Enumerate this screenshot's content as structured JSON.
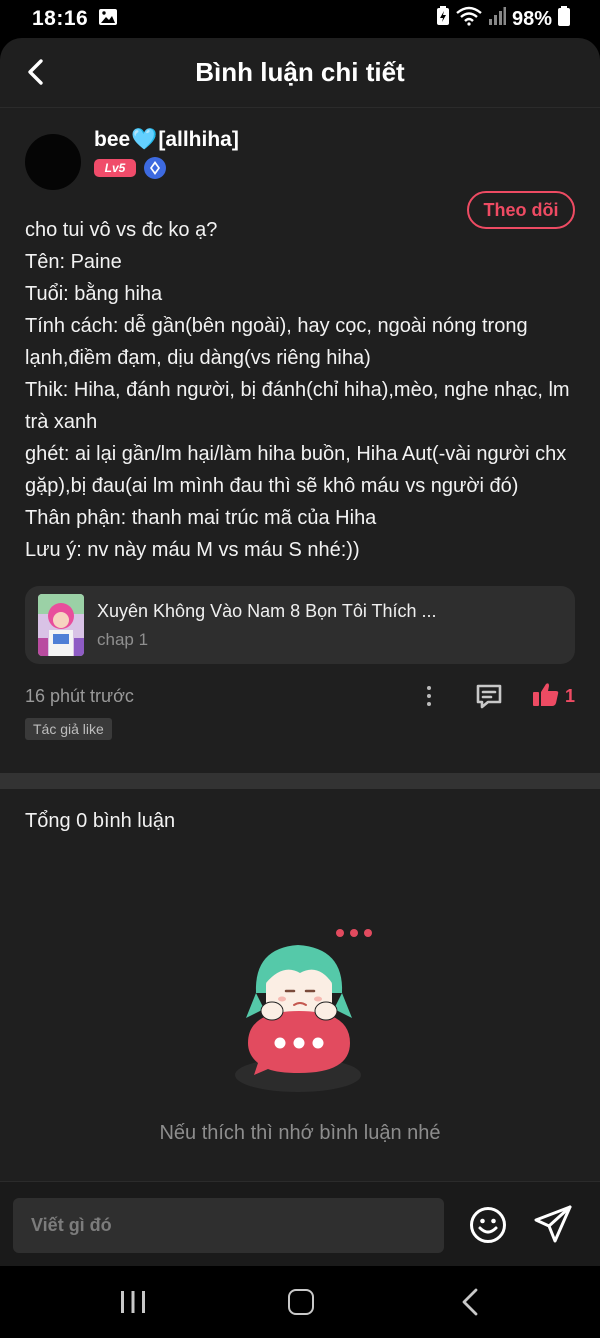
{
  "status_bar": {
    "time": "18:16",
    "battery": "98%",
    "icons": [
      "gallery-icon",
      "battery-saver-icon",
      "wifi-icon",
      "signal-icon",
      "battery-icon"
    ]
  },
  "header": {
    "title": "Bình luận chi tiết",
    "back_icon": "chevron-left-icon"
  },
  "post": {
    "author": {
      "name_prefix": "bee",
      "name_heart": "🩵",
      "name_suffix": "[allhiha]",
      "level": "Lv5"
    },
    "follow_label": "Theo dõi",
    "lines": [
      "cho tui vô vs đc ko ạ?",
      "Tên: Paine",
      "Tuổi: bằng hiha",
      "Tính cách: dễ gần(bên ngoài), hay cọc, ngoài nóng trong lạnh,điềm đạm, dịu dàng(vs riêng hiha)",
      "Thik: Hiha, đánh người, bị đánh(chỉ hiha),mèo, nghe nhạc, lm trà xanh",
      "ghét: ai lại gần/lm hại/làm hiha buồn, Hiha Aut(-vài người chx gặp),bị đau(ai lm mình đau thì sẽ khô máu vs người đó)",
      "Thân phận: thanh mai trúc mã của Hiha",
      "Lưu ý: nv này máu M vs máu S nhé:))"
    ],
    "story": {
      "title": "Xuyên Không Vào Nam 8 Bọn Tôi Thích ...",
      "chapter": "chap 1"
    },
    "time_ago": "16 phút trước",
    "like_count": "1",
    "tag": "Tác giả like"
  },
  "comments": {
    "title": "Tổng 0 bình luận",
    "empty_text": "Nếu thích thì nhớ bình luận nhé"
  },
  "input": {
    "placeholder": "Viết gì đó"
  },
  "colors": {
    "accent": "#ee4b63",
    "background": "#1f1f1f",
    "card": "#2e2e2e"
  }
}
